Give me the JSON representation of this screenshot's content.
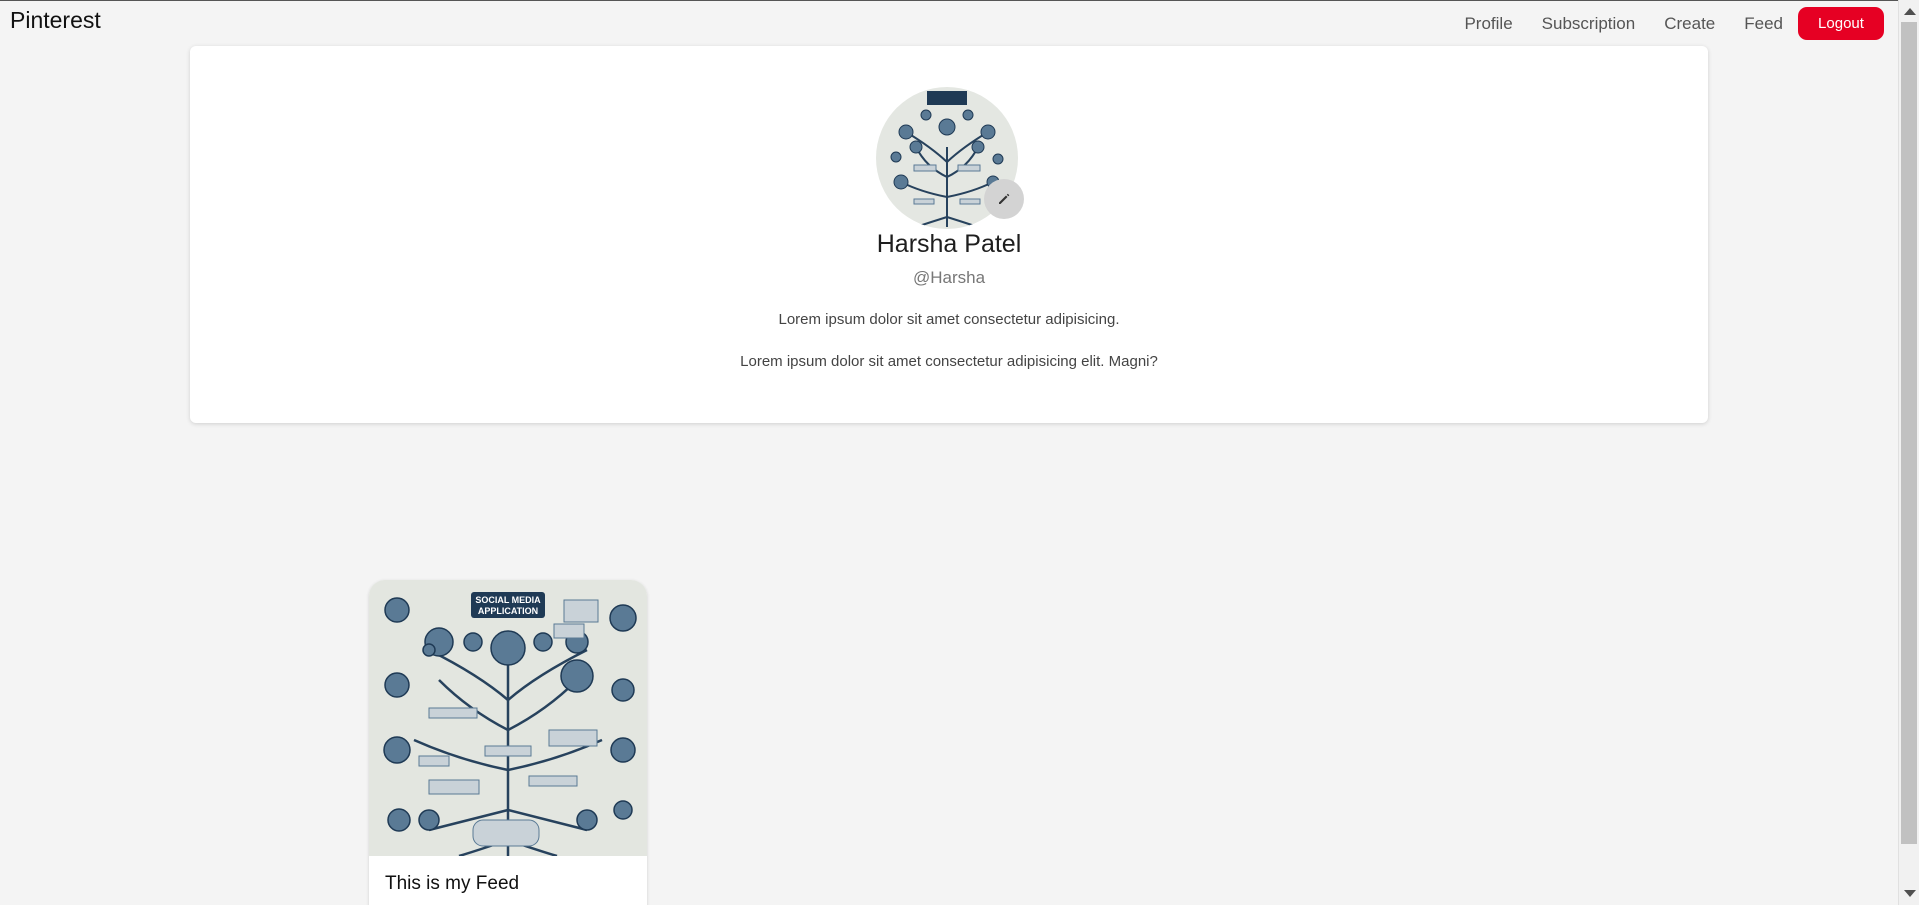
{
  "header": {
    "brand": "Pinterest",
    "nav": [
      "Profile",
      "Subscription",
      "Create",
      "Feed"
    ],
    "logout_label": "Logout"
  },
  "profile": {
    "avatar_icon": "tech-tree-illustration",
    "edit_icon": "pencil-icon",
    "name": "Harsha Patel",
    "handle": "@Harsha",
    "bio_line1": "Lorem ipsum dolor sit amet consectetur adipisicing.",
    "bio_line2": "Lorem ipsum dolor sit amet consectetur adipisicing elit. Magni?"
  },
  "pins": [
    {
      "image_icon": "tech-tree-illustration",
      "image_caption": "SOCIAL MEDIA APPLICATION",
      "title": "This is my Feed"
    }
  ],
  "colors": {
    "brand_red": "#e60023",
    "background": "#f4f4f4",
    "illustration_navy": "#1f3a55"
  }
}
